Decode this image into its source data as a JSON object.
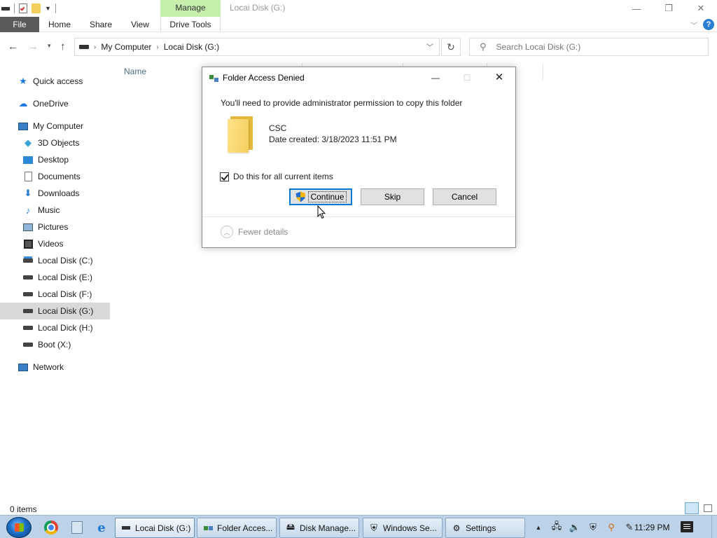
{
  "window": {
    "title": "Locai Disk (G:)",
    "context_tab": "Manage",
    "minimize_icon": "minimize-icon",
    "restore_icon": "restore-icon",
    "close_icon": "close-icon"
  },
  "ribbon": {
    "tabs": [
      "File",
      "Home",
      "Share",
      "View",
      "Drive Tools"
    ]
  },
  "address": {
    "crumbs": [
      "My Computer",
      "Locai Disk (G:)"
    ],
    "search_placeholder": "Search Locai Disk (G:)"
  },
  "sidebar": {
    "items": [
      {
        "label": "Quick access",
        "icon": "star-icon"
      },
      {
        "label": "OneDrive",
        "icon": "cloud-icon"
      },
      {
        "label": "My Computer",
        "icon": "computer-icon"
      },
      {
        "label": "3D Objects",
        "icon": "cube-icon"
      },
      {
        "label": "Desktop",
        "icon": "desktop-icon"
      },
      {
        "label": "Documents",
        "icon": "document-icon"
      },
      {
        "label": "Downloads",
        "icon": "download-icon"
      },
      {
        "label": "Music",
        "icon": "music-icon"
      },
      {
        "label": "Pictures",
        "icon": "pictures-icon"
      },
      {
        "label": "Videos",
        "icon": "video-icon"
      },
      {
        "label": "Local Disk (C:)",
        "icon": "drive-icon"
      },
      {
        "label": "Local Disk (E:)",
        "icon": "drive-icon"
      },
      {
        "label": "Local Disk (F:)",
        "icon": "drive-icon"
      },
      {
        "label": "Locai Disk (G:)",
        "icon": "drive-icon",
        "selected": true
      },
      {
        "label": "Local Dick (H:)",
        "icon": "drive-icon"
      },
      {
        "label": "Boot (X:)",
        "icon": "drive-icon"
      },
      {
        "label": "Network",
        "icon": "network-icon"
      }
    ]
  },
  "content": {
    "column_name": "Name"
  },
  "status": {
    "item_count": "0 items"
  },
  "dialog": {
    "title": "Folder Access Denied",
    "message": "You'll need to provide administrator permission to copy this folder",
    "folder_name": "CSC",
    "date_created": "Date created: 3/18/2023 11:51 PM",
    "checkbox_label": "Do this for all current items",
    "checkbox_checked": true,
    "continue_label": "Continue",
    "skip_label": "Skip",
    "cancel_label": "Cancel",
    "details_label": "Fewer details"
  },
  "taskbar": {
    "tasks": [
      "Locai Disk (G:)",
      "Folder Acces...",
      "Disk Manage...",
      "Windows Se...",
      "Settings"
    ],
    "clock": "11:29 PM"
  },
  "colors": {
    "manage_tab": "#c6efae",
    "file_tab": "#5a5a5a",
    "selected_item": "#d9d9d9",
    "taskbar": "#bcd2e8",
    "focus_border": "#0078d7"
  }
}
